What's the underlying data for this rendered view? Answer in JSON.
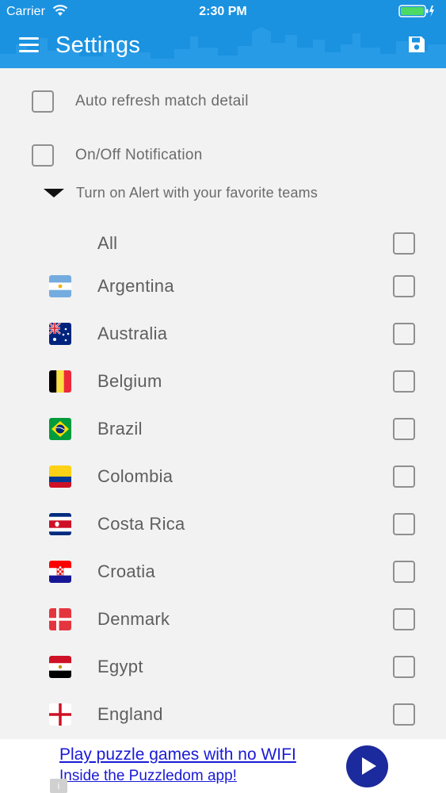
{
  "status_bar": {
    "carrier": "Carrier",
    "time": "2:30 PM",
    "wifi_icon": "wifi-icon",
    "battery_icon": "battery-charging-icon"
  },
  "header": {
    "title": "Settings",
    "menu_icon": "hamburger-menu-icon",
    "save_icon": "floppy-disk-save-icon",
    "background_color": "#1a92e0"
  },
  "settings": {
    "auto_refresh_label": "Auto refresh match detail",
    "auto_refresh_checked": false,
    "notification_label": "On/Off Notification",
    "notification_checked": false,
    "alert_label": "Turn on Alert with your favorite teams",
    "alert_expanded": true
  },
  "teams": [
    {
      "name": "All",
      "checked": false,
      "flag": ""
    },
    {
      "name": "Argentina",
      "checked": false,
      "flag": "argentina-flag-icon"
    },
    {
      "name": "Australia",
      "checked": false,
      "flag": "australia-flag-icon"
    },
    {
      "name": "Belgium",
      "checked": false,
      "flag": "belgium-flag-icon"
    },
    {
      "name": "Brazil",
      "checked": false,
      "flag": "brazil-flag-icon"
    },
    {
      "name": "Colombia",
      "checked": false,
      "flag": "colombia-flag-icon"
    },
    {
      "name": "Costa Rica",
      "checked": false,
      "flag": "costa-rica-flag-icon"
    },
    {
      "name": "Croatia",
      "checked": false,
      "flag": "croatia-flag-icon"
    },
    {
      "name": "Denmark",
      "checked": false,
      "flag": "denmark-flag-icon"
    },
    {
      "name": "Egypt",
      "checked": false,
      "flag": "egypt-flag-icon"
    },
    {
      "name": "England",
      "checked": false,
      "flag": "england-flag-icon"
    }
  ],
  "ad": {
    "line1": "Play puzzle games with no WIFI",
    "line2": "Inside the Puzzledom app!",
    "play_icon": "play-icon",
    "info_icon": "info-icon",
    "link_color": "#1a1ad6"
  }
}
